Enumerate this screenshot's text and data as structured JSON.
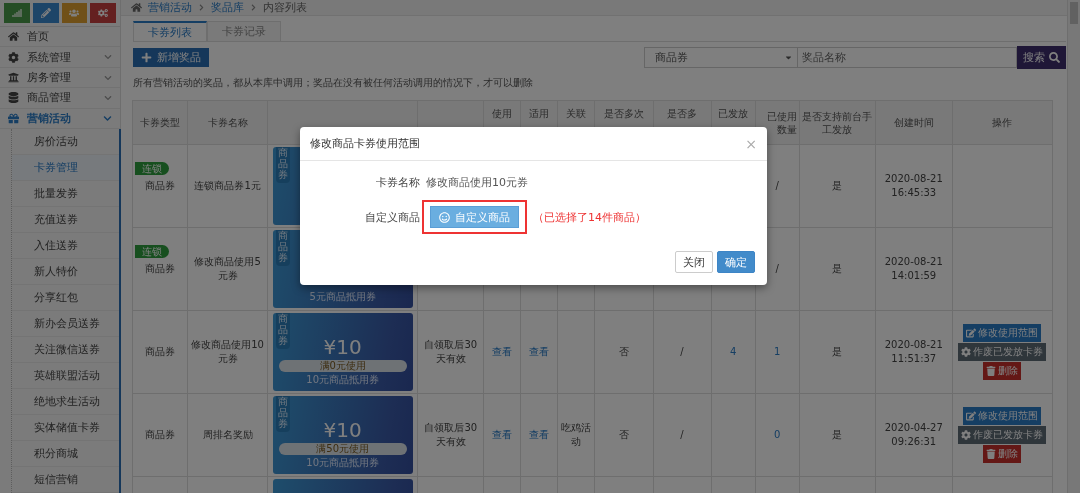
{
  "sidebar": {
    "items": [
      {
        "label": "首页",
        "kind": "link",
        "selected": false
      },
      {
        "label": "系统管理",
        "kind": "group",
        "expanded": false,
        "selected": false
      },
      {
        "label": "房务管理",
        "kind": "group",
        "expanded": false,
        "selected": false
      },
      {
        "label": "商品管理",
        "kind": "group",
        "expanded": false,
        "selected": false
      },
      {
        "label": "营销活动",
        "kind": "group",
        "expanded": true,
        "selected": true,
        "children": [
          {
            "label": "房价活动",
            "selected": false
          },
          {
            "label": "卡券管理",
            "selected": true
          },
          {
            "label": "批量发券",
            "selected": false
          },
          {
            "label": "充值送券",
            "selected": false
          },
          {
            "label": "入住送券",
            "selected": false
          },
          {
            "label": "新人特价",
            "selected": false
          },
          {
            "label": "分享红包",
            "selected": false
          },
          {
            "label": "新办会员送券",
            "selected": false
          },
          {
            "label": "关注微信送券",
            "selected": false
          },
          {
            "label": "英雄联盟活动",
            "selected": false
          },
          {
            "label": "绝地求生活动",
            "selected": false
          },
          {
            "label": "实体储值卡券",
            "selected": false
          },
          {
            "label": "积分商城",
            "selected": false
          },
          {
            "label": "短信营销",
            "selected": false
          }
        ]
      }
    ]
  },
  "breadcrumb": [
    "营销活动",
    "奖品库",
    "内容列表"
  ],
  "tabs": [
    {
      "label": "卡券列表",
      "selected": true
    },
    {
      "label": "卡券记录",
      "selected": false
    }
  ],
  "add_button": "新增奖品",
  "filter": {
    "select": "商品券",
    "placeholder": "奖品名称",
    "search_button": "搜索"
  },
  "note": "所有营销活动的奖品，都从本库中调用；奖品在没有被任何活动调用的情况下，才可以删除",
  "table": {
    "columns": [
      "卡券类型",
      "卡券名称",
      "",
      "",
      "使用",
      "适用",
      "关联",
      "是否多次",
      "是否多",
      "已发放",
      "已使用数量",
      "是否支持前台手工发放",
      "创建时间",
      "操作"
    ],
    "rows": [
      {
        "badge": "连锁",
        "type": "商品券",
        "name": "连锁商品券1元",
        "coupon": {
          "tag": "商品券"
        },
        "used": "/",
        "manual": "是",
        "created": "2020-08-21 16:45:33"
      },
      {
        "badge": "连锁",
        "type": "商品券",
        "name": "修改商品使用5元券",
        "coupon": {
          "tag": "商品券",
          "subtitle": "5元商品抵用券"
        },
        "used": "/",
        "manual": "是",
        "created": "2020-08-21 14:01:59"
      },
      {
        "type": "商品券",
        "name": "修改商品使用10元券",
        "coupon": {
          "tag": "商品券",
          "amount": "¥10",
          "condition": "满0元使用",
          "subtitle": "10元商品抵用券"
        },
        "validity": "自领取后30天有效",
        "usage": "查看",
        "scope": "查看",
        "multi": "否",
        "multi2": "/",
        "issued": "4",
        "used": "1",
        "manual": "是",
        "created": "2020-08-21 11:51:37",
        "actions": [
          {
            "kind": "edit",
            "label": "修改使用范围"
          },
          {
            "kind": "void",
            "label": "作废已发放卡券"
          },
          {
            "kind": "delete",
            "label": "删除"
          }
        ]
      },
      {
        "type": "商品券",
        "name": "周排名奖励",
        "coupon": {
          "tag": "商品券",
          "amount": "¥10",
          "condition": "满50元使用",
          "subtitle": "10元商品抵用券"
        },
        "validity": "自领取后30天有效",
        "usage": "查看",
        "scope": "查看",
        "activity": "吃鸡活动",
        "multi": "否",
        "multi2": "/",
        "used": "0",
        "manual": "是",
        "created": "2020-04-27 09:26:31",
        "actions": [
          {
            "kind": "edit",
            "label": "修改使用范围"
          },
          {
            "kind": "void",
            "label": "作废已发放卡券"
          },
          {
            "kind": "delete",
            "label": "删除"
          }
        ]
      }
    ]
  },
  "modal": {
    "title": "修改商品卡券使用范围",
    "close": "×",
    "fields": [
      {
        "kind": "text",
        "label": "卡券名称",
        "value": "修改商品使用10元券"
      },
      {
        "kind": "picker",
        "label": "自定义商品",
        "button": "自定义商品",
        "highlighted": true,
        "hint": "（已选择了14件商品）"
      }
    ],
    "buttons": [
      {
        "kind": "default",
        "label": "关闭"
      },
      {
        "kind": "primary",
        "label": "确定"
      }
    ]
  }
}
